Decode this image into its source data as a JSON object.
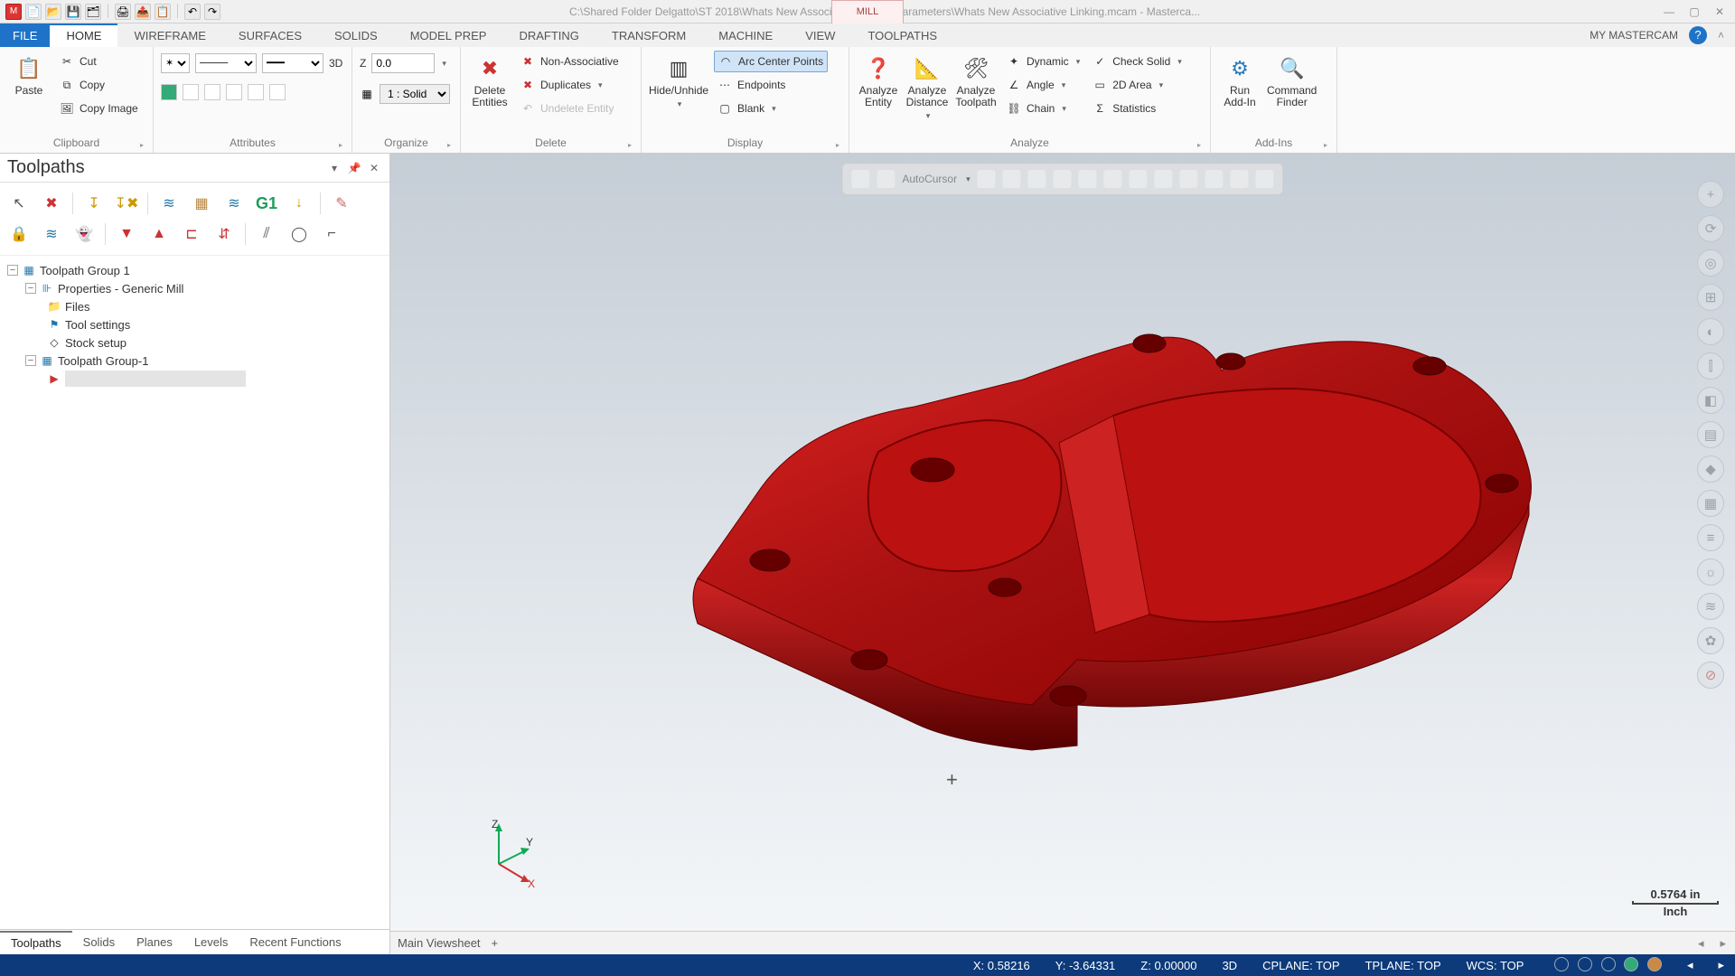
{
  "titlebar": {
    "mill_tab": "MILL",
    "path": "C:\\Shared Folder Delgatto\\ST 2018\\Whats New Associative Linking Parameters\\Whats New Associative Linking.mcam - Masterca..."
  },
  "menu": {
    "file": "FILE",
    "tabs": [
      "HOME",
      "WIREFRAME",
      "SURFACES",
      "SOLIDS",
      "MODEL PREP",
      "DRAFTING",
      "TRANSFORM",
      "MACHINE",
      "VIEW",
      "TOOLPATHS"
    ],
    "my": "MY MASTERCAM"
  },
  "ribbon": {
    "clipboard": {
      "label": "Clipboard",
      "paste": "Paste",
      "cut": "Cut",
      "copy": "Copy",
      "copyimg": "Copy Image"
    },
    "attributes": {
      "label": "Attributes",
      "mode": "3D",
      "solid": "1 : Solid"
    },
    "organize": {
      "label": "Organize",
      "z": "Z",
      "zval": "0.0"
    },
    "delete": {
      "label": "Delete",
      "entities": "Delete\nEntities",
      "nonassoc": "Non-Associative",
      "dup": "Duplicates",
      "undelete": "Undelete Entity"
    },
    "display": {
      "label": "Display",
      "hide": "Hide/Unhide",
      "arc": "Arc Center Points",
      "end": "Endpoints",
      "blank": "Blank"
    },
    "analyze": {
      "label": "Analyze",
      "entity": "Analyze\nEntity",
      "distance": "Analyze\nDistance",
      "toolpath": "Analyze\nToolpath",
      "dynamic": "Dynamic",
      "angle": "Angle",
      "chain": "Chain",
      "check": "Check Solid",
      "area": "2D Area",
      "stats": "Statistics"
    },
    "addins": {
      "label": "Add-Ins",
      "run": "Run\nAdd-In",
      "cmd": "Command\nFinder"
    }
  },
  "panel": {
    "title": "Toolpaths",
    "toolbar_g1": "G1",
    "tree": {
      "root": "Toolpath Group 1",
      "props": "Properties - Generic Mill",
      "files": "Files",
      "toolset": "Tool settings",
      "stock": "Stock setup",
      "group1": "Toolpath Group-1"
    },
    "tabs": [
      "Toolpaths",
      "Solids",
      "Planes",
      "Levels",
      "Recent Functions"
    ]
  },
  "viewport": {
    "autocursor": "AutoCursor",
    "viewsheet": "Main Viewsheet",
    "scale_val": "0.5764 in",
    "scale_unit": "Inch",
    "axis_z": "Z",
    "axis_y": "Y",
    "axis_x": "X"
  },
  "status": {
    "x": "X:   0.58216",
    "y": "Y:   -3.64331",
    "z": "Z:   0.00000",
    "mode": "3D",
    "cplane": "CPLANE: TOP",
    "tplane": "TPLANE: TOP",
    "wcs": "WCS: TOP"
  }
}
